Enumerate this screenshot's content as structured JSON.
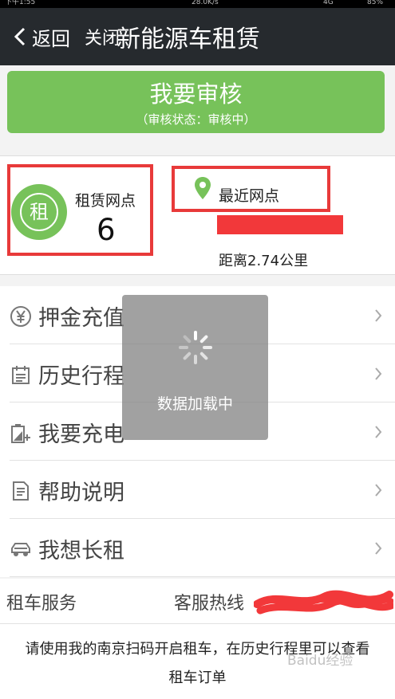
{
  "status_bar": {
    "time": "下午1:55",
    "speed": "28.0K/s",
    "network": "4G",
    "battery": "85%"
  },
  "header": {
    "back_label": "返回",
    "close_label": "关闭",
    "title": "新能源车租赁"
  },
  "audit": {
    "title": "我要审核",
    "status": "（审核状态：审核中）",
    "color": "#77c25a"
  },
  "outlets": {
    "avatar_char": "租",
    "label": "租赁网点",
    "count": "6"
  },
  "nearest": {
    "label": "最近网点",
    "distance": "距离2.74公里"
  },
  "menu": [
    {
      "label": "押金充值",
      "icon": "yen-icon"
    },
    {
      "label": "历史行程",
      "icon": "calendar-icon"
    },
    {
      "label": "我要充电",
      "icon": "battery-icon"
    },
    {
      "label": "帮助说明",
      "icon": "document-icon"
    },
    {
      "label": "我想长租",
      "icon": "car-icon"
    }
  ],
  "service": {
    "label": "租车服务",
    "hotline_label": "客服热线"
  },
  "footer": {
    "line1": "请使用我的南京扫码开启租车，在历史行程里可以查看",
    "line2": "租车订单"
  },
  "loading": {
    "text": "数据加载中"
  },
  "watermark": "Baidu经验",
  "colors": {
    "accent": "#77c25a",
    "header_bg": "#262a2e",
    "annotation": "#e83a3a"
  }
}
